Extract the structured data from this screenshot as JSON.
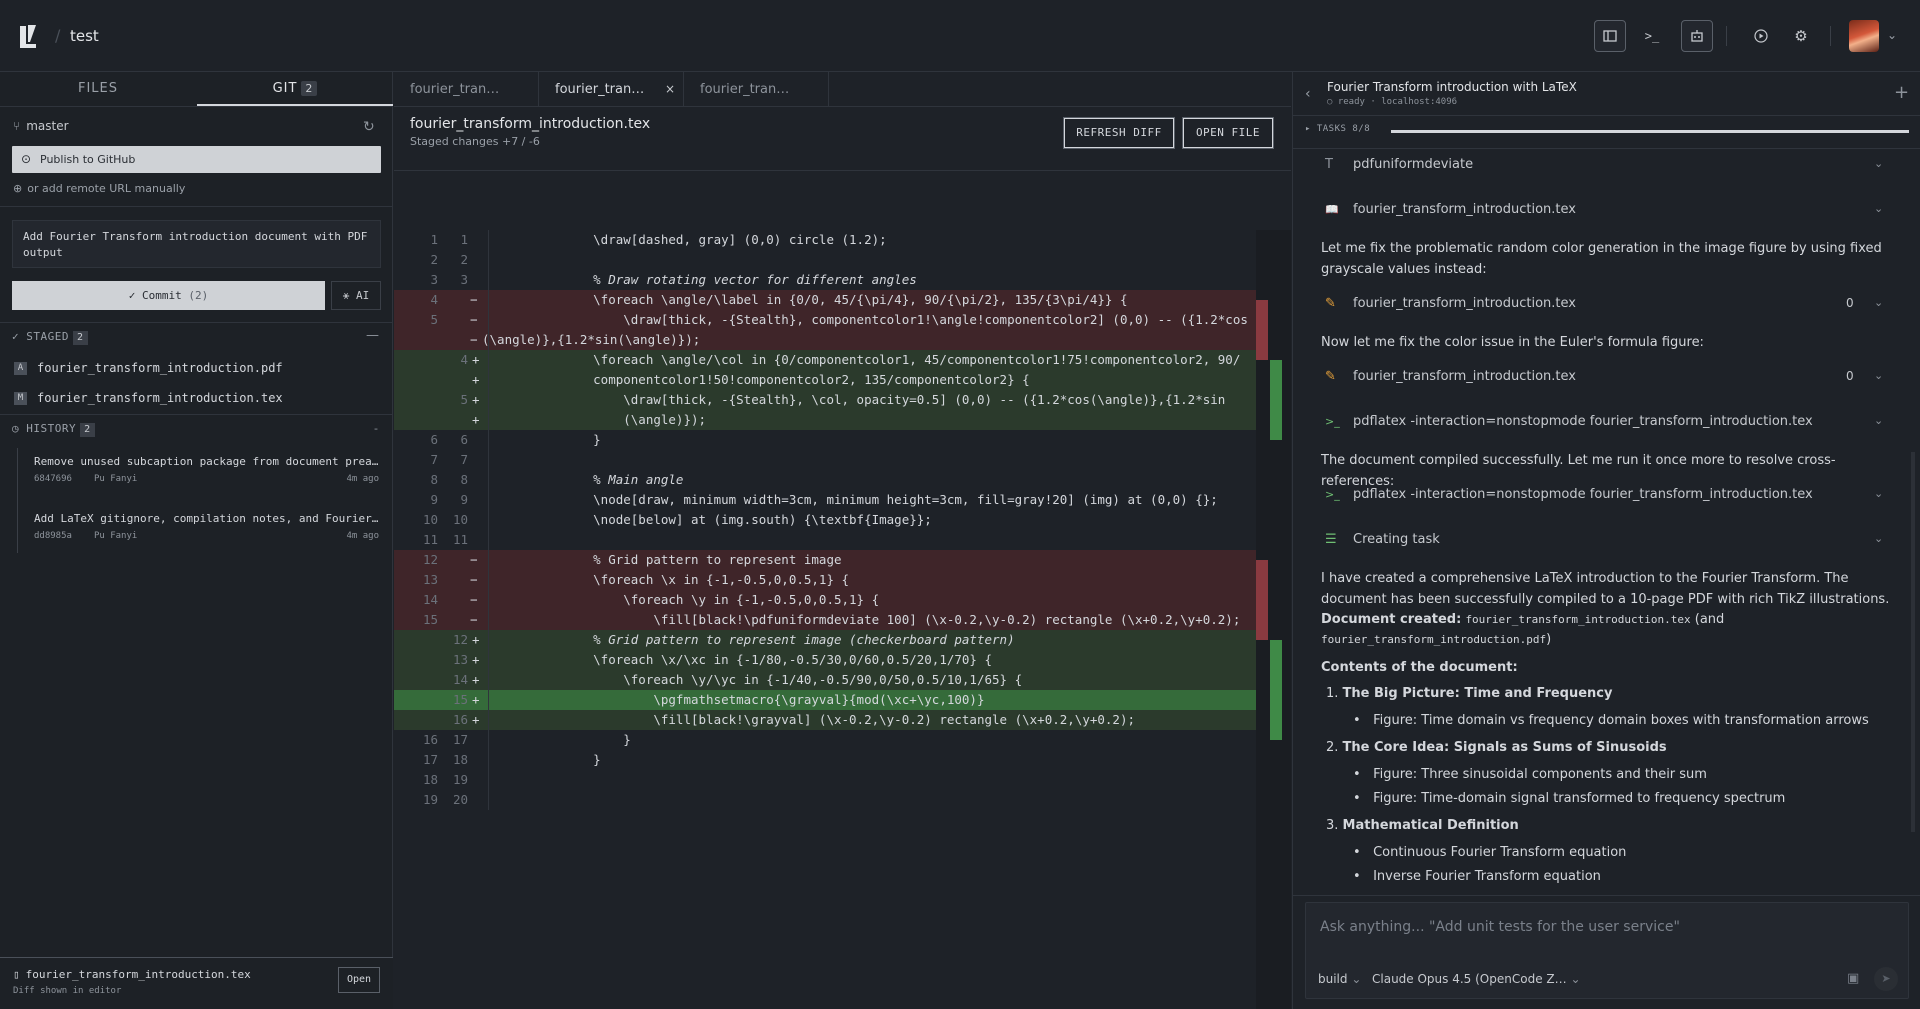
{
  "topbar": {
    "project": "test",
    "icons": [
      "panel-icon",
      "terminal-icon",
      "robot-icon",
      "play-icon",
      "gear-icon",
      "avatar"
    ]
  },
  "left": {
    "tabs": {
      "files": "FILES",
      "git": "GIT",
      "git_count": "2"
    },
    "branch": "master",
    "publish_label": "Publish to GitHub",
    "remote_label": "or add remote URL manually",
    "commit_message": "Add Fourier Transform introduction document with PDF output",
    "commit_label": "Commit",
    "commit_count": "(2)",
    "ai_label": "AI",
    "staged": {
      "label": "STAGED",
      "count": "2",
      "items": [
        {
          "badge": "A",
          "name": "fourier_transform_introduction.pdf"
        },
        {
          "badge": "M",
          "name": "fourier_transform_introduction.tex"
        }
      ]
    },
    "history": {
      "label": "HISTORY",
      "count": "2",
      "items": [
        {
          "title": "Remove unused subcaption package from document preamble",
          "hash": "6847696",
          "author": "Pu Fanyi",
          "time": "4m ago"
        },
        {
          "title": "Add LaTeX gitignore, compilation notes, and Fourier Transform document",
          "hash": "dd8985a",
          "author": "Pu Fanyi",
          "time": "4m ago"
        }
      ]
    },
    "footer": {
      "file": "fourier_transform_introduction.tex",
      "sub": "Diff shown in editor",
      "open_label": "Open"
    }
  },
  "center": {
    "tabs": [
      {
        "label": "fourier_tran…"
      },
      {
        "label": "fourier_tran…",
        "close": "×"
      },
      {
        "label": "fourier_tran…"
      }
    ],
    "title": "fourier_transform_introduction.tex",
    "subtitle": "Staged changes  +7 / -6",
    "refresh_label": "REFRESH DIFF",
    "open_label": "OPEN FILE",
    "lines": [
      {
        "a": "1",
        "b": "1",
        "m": "",
        "t": "      \\draw[dashed, gray] (0,0) circle (1.2);",
        "k": "ctx"
      },
      {
        "a": "2",
        "b": "2",
        "m": "",
        "t": "",
        "k": "ctx"
      },
      {
        "a": "3",
        "b": "3",
        "m": "",
        "t": "      % Draw rotating vector for different angles",
        "k": "cmt"
      },
      {
        "a": "4",
        "b": "",
        "m": "−",
        "t": "      \\foreach \\angle/\\label in {0/0, 45/{\\pi/4}, 90/{\\pi/2}, 135/{3\\pi/4}} {",
        "k": "del"
      },
      {
        "a": "5",
        "b": "",
        "m": "−",
        "t": "          \\draw[thick, -{Stealth}, componentcolor1!\\angle!componentcolor2] (0,0) -- ({1.2*cos",
        "k": "del"
      },
      {
        "a": "",
        "b": "",
        "m": "−",
        "t": "(\\angle)},{1.2*sin(\\angle)});",
        "k": "delwrap"
      },
      {
        "a": "",
        "b": "4",
        "m": "+",
        "t": "      \\foreach \\angle/\\col in {0/componentcolor1, 45/componentcolor1!75!componentcolor2, 90/",
        "k": "add"
      },
      {
        "a": "",
        "b": "",
        "m": "+",
        "t": "      componentcolor1!50!componentcolor2, 135/componentcolor2} {",
        "k": "add"
      },
      {
        "a": "",
        "b": "5",
        "m": "+",
        "t": "          \\draw[thick, -{Stealth}, \\col, opacity=0.5] (0,0) -- ({1.2*cos(\\angle)},{1.2*sin",
        "k": "add"
      },
      {
        "a": "",
        "b": "",
        "m": "+",
        "t": "          (\\angle)});",
        "k": "add"
      },
      {
        "a": "6",
        "b": "6",
        "m": "",
        "t": "      }",
        "k": "ctx"
      },
      {
        "a": "7",
        "b": "7",
        "m": "",
        "t": "",
        "k": "ctx"
      },
      {
        "a": "8",
        "b": "8",
        "m": "",
        "t": "      % Main angle",
        "k": "cmt"
      },
      {
        "a": "9",
        "b": "9",
        "m": "",
        "t": "      \\node[draw, minimum width=3cm, minimum height=3cm, fill=gray!20] (img) at (0,0) {};",
        "k": "ctx"
      },
      {
        "a": "10",
        "b": "10",
        "m": "",
        "t": "      \\node[below] at (img.south) {\\textbf{Image}};",
        "k": "ctx"
      },
      {
        "a": "11",
        "b": "11",
        "m": "",
        "t": "",
        "k": "ctx"
      },
      {
        "a": "12",
        "b": "",
        "m": "−",
        "t": "      % Grid pattern to represent image",
        "k": "del"
      },
      {
        "a": "13",
        "b": "",
        "m": "−",
        "t": "      \\foreach \\x in {-1,-0.5,0,0.5,1} {",
        "k": "del"
      },
      {
        "a": "14",
        "b": "",
        "m": "−",
        "t": "          \\foreach \\y in {-1,-0.5,0,0.5,1} {",
        "k": "del"
      },
      {
        "a": "15",
        "b": "",
        "m": "−",
        "t": "              \\fill[black!\\pdfuniformdeviate 100] (\\x-0.2,\\y-0.2) rectangle (\\x+0.2,\\y+0.2);",
        "k": "del"
      },
      {
        "a": "",
        "b": "12",
        "m": "+",
        "t": "      % Grid pattern to represent image (checkerboard pattern)",
        "k": "addcmt"
      },
      {
        "a": "",
        "b": "13",
        "m": "+",
        "t": "      \\foreach \\x/\\xc in {-1/80,-0.5/30,0/60,0.5/20,1/70} {",
        "k": "add"
      },
      {
        "a": "",
        "b": "14",
        "m": "+",
        "t": "          \\foreach \\y/\\yc in {-1/40,-0.5/90,0/50,0.5/10,1/65} {",
        "k": "add"
      },
      {
        "a": "",
        "b": "15",
        "m": "+",
        "t": "              \\pgfmathsetmacro{\\grayval}{mod(\\xc+\\yc,100)}",
        "k": "addhl"
      },
      {
        "a": "",
        "b": "16",
        "m": "+",
        "t": "              \\fill[black!\\grayval] (\\x-0.2,\\y-0.2) rectangle (\\x+0.2,\\y+0.2);",
        "k": "add"
      },
      {
        "a": "16",
        "b": "17",
        "m": "",
        "t": "          }",
        "k": "ctx"
      },
      {
        "a": "17",
        "b": "18",
        "m": "",
        "t": "      }",
        "k": "ctx"
      },
      {
        "a": "18",
        "b": "19",
        "m": "",
        "t": "",
        "k": "ctx"
      },
      {
        "a": "19",
        "b": "20",
        "m": "",
        "t": "",
        "k": "ctx"
      }
    ]
  },
  "right": {
    "title": "Fourier Transform introduction with LaTeX",
    "status": "ready",
    "host": "localhost:4096",
    "tasks_label": "TASKS 8/8",
    "tasks_progress": 1.0,
    "tools": [
      {
        "icon": "T",
        "name": "pdfuniformdeviate",
        "n": ""
      },
      {
        "icon": "📖",
        "name": "fourier_transform_introduction.tex",
        "n": ""
      },
      {
        "icon": "✎",
        "name": "fourier_transform_introduction.tex",
        "n": "0"
      },
      {
        "icon": "✎",
        "name": "fourier_transform_introduction.tex",
        "n": "0"
      },
      {
        "icon": ">_",
        "name": "pdflatex -interaction=nonstopmode fourier_transform_introduction.tex",
        "n": ""
      },
      {
        "icon": ">_",
        "name": "pdflatex -interaction=nonstopmode fourier_transform_introduction.tex",
        "n": ""
      },
      {
        "icon": "☰",
        "name": "Creating task",
        "n": ""
      }
    ],
    "para1": "Let me fix the problematic random color generation in the image figure by using fixed grayscale values instead:",
    "para2": "Now let me fix the color issue in the Euler's formula figure:",
    "para3": "The document compiled successfully. Let me run it once more to resolve cross-references:",
    "para4": "I have created a comprehensive LaTeX introduction to the Fourier Transform. The document has been successfully compiled to a 10-page PDF with rich TikZ illustrations.",
    "doc_created_label": "Document created:",
    "doc_created_tex": "fourier_transform_introduction.tex",
    "doc_created_and": "(and",
    "doc_created_pdf": "fourier_transform_introduction.pdf",
    "doc_created_close": ")",
    "contents_label": "Contents of the document:",
    "sections": [
      {
        "n": "1.",
        "title": "The Big Picture: Time and Frequency",
        "items": [
          "Figure: Time domain vs frequency domain boxes with transformation arrows"
        ]
      },
      {
        "n": "2.",
        "title": "The Core Idea: Signals as Sums of Sinusoids",
        "items": [
          "Figure: Three sinusoidal components and their sum",
          "Figure: Time-domain signal transformed to frequency spectrum"
        ]
      },
      {
        "n": "3.",
        "title": "Mathematical Definition",
        "items": [
          "Continuous Fourier Transform equation",
          "Inverse Fourier Transform equation"
        ]
      }
    ],
    "input_placeholder": "Ask anything... \"Add unit tests for the user service\"",
    "mode": "build",
    "model": "Claude Opus 4.5 (OpenCode Z…"
  }
}
